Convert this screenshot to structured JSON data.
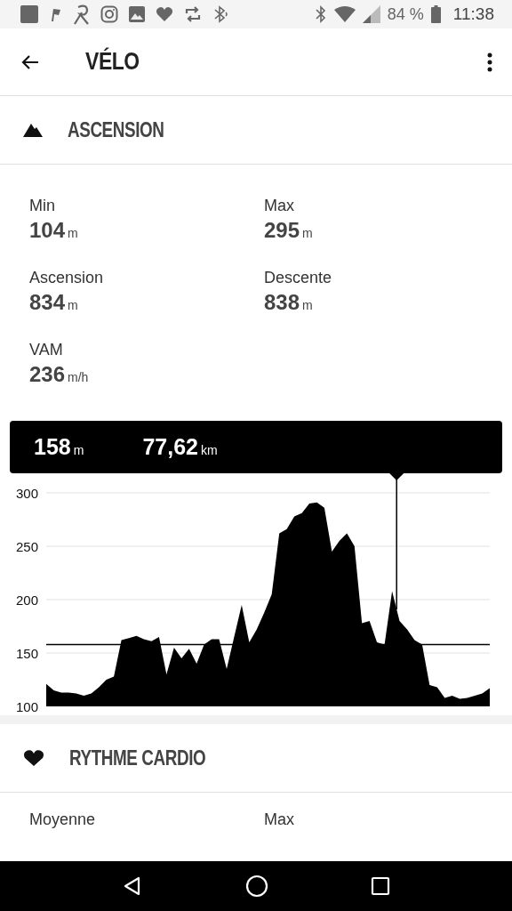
{
  "status_bar": {
    "battery": "84 %",
    "time": "11:38"
  },
  "app_bar": {
    "title": "VÉLO"
  },
  "sections": [
    {
      "kind": "ascension",
      "title": "ASCENSION"
    },
    {
      "kind": "heart",
      "title": "RYTHME CARDIO"
    }
  ],
  "ascension_stats": [
    {
      "label": "Min",
      "value": "104",
      "unit": "m"
    },
    {
      "label": "Max",
      "value": "295",
      "unit": "m"
    },
    {
      "label": "Ascension",
      "value": "834",
      "unit": "m"
    },
    {
      "label": "Descente",
      "value": "838",
      "unit": "m"
    },
    {
      "label": "VAM",
      "value": "236",
      "unit": "m/h"
    }
  ],
  "cursor": {
    "altitude": "158",
    "altitude_unit": "m",
    "distance": "77,62",
    "distance_unit": "km"
  },
  "chart_data": {
    "type": "area",
    "ylim": [
      100,
      300
    ],
    "yticks": [
      100,
      150,
      200,
      250,
      300
    ],
    "grid": true,
    "series": [
      {
        "color": "#000000",
        "values": [
          121,
          115,
          113,
          113,
          112,
          110,
          112,
          118,
          125,
          128,
          162,
          164,
          166,
          163,
          161,
          165,
          130,
          155,
          145,
          154,
          140,
          158,
          163,
          163,
          135,
          165,
          195,
          160,
          172,
          188,
          205,
          262,
          266,
          278,
          281,
          290,
          291,
          286,
          245,
          255,
          262,
          250,
          178,
          180,
          160,
          158,
          208,
          180,
          172,
          162,
          158,
          120,
          118,
          108,
          110,
          107,
          108,
          110,
          112,
          117
        ]
      }
    ],
    "ref_lines": [
      {
        "axis": "y",
        "value": 158
      }
    ]
  },
  "heart_stats": [
    {
      "label": "Moyenne"
    },
    {
      "label": "Max"
    }
  ]
}
